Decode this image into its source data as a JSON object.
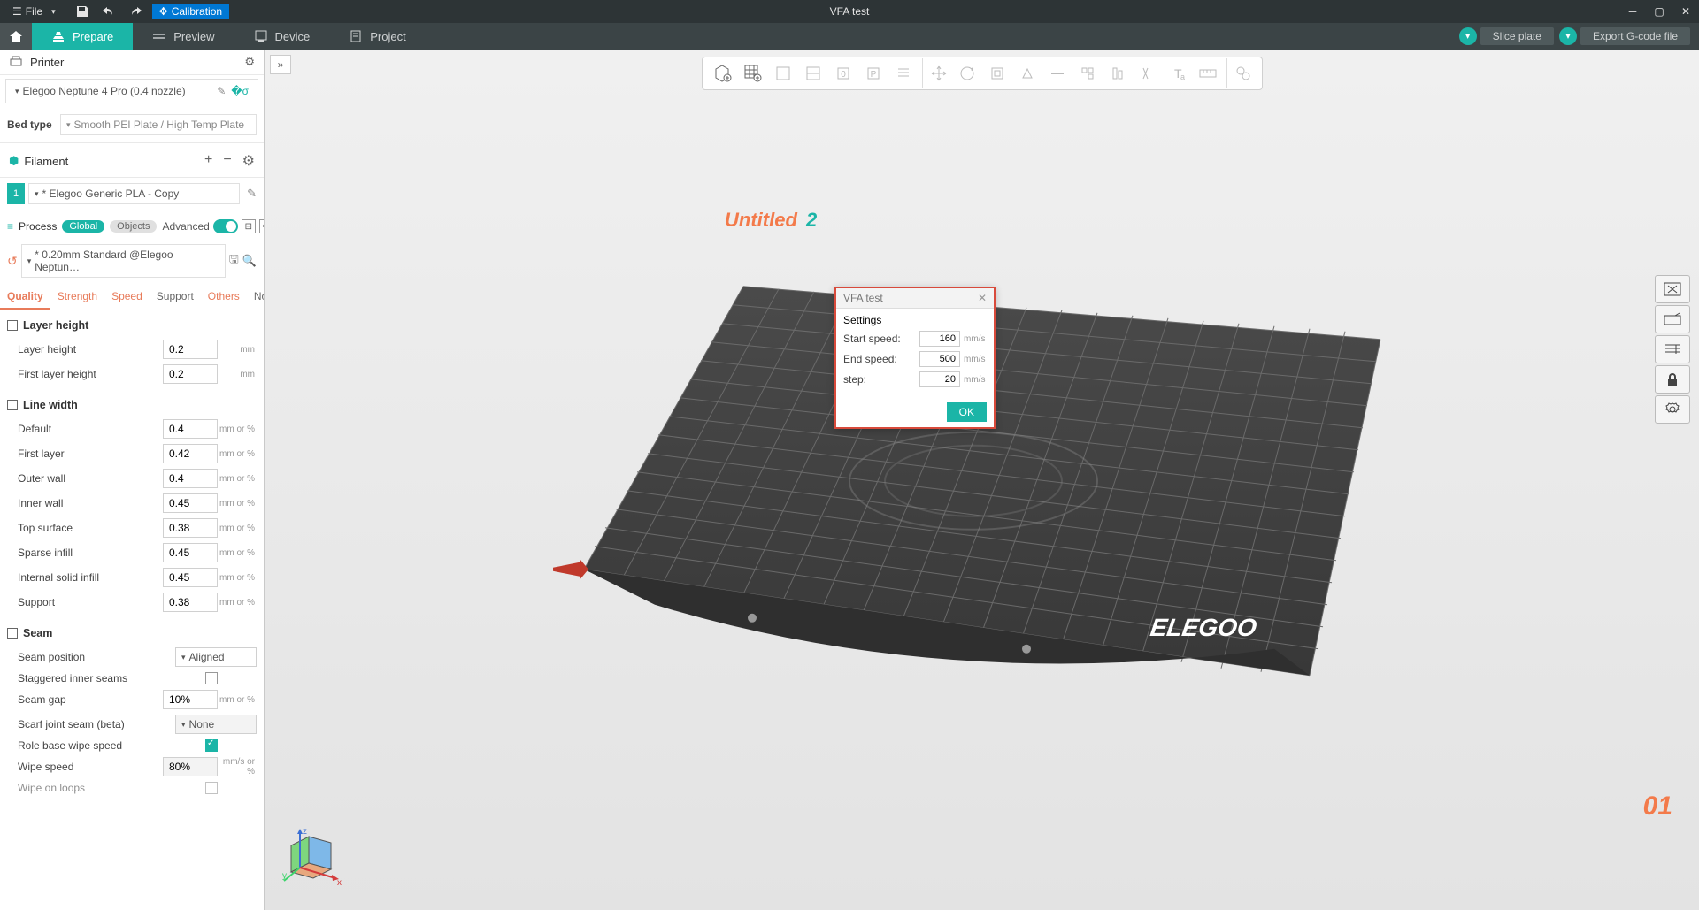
{
  "titlebar": {
    "file_label": "File",
    "calibration_label": "Calibration",
    "title": "VFA test"
  },
  "tabs": {
    "prepare": "Prepare",
    "preview": "Preview",
    "device": "Device",
    "project": "Project"
  },
  "actions": {
    "slice": "Slice plate",
    "export": "Export G-code file"
  },
  "panels": {
    "printer": {
      "title": "Printer",
      "selected": "Elegoo Neptune 4 Pro (0.4 nozzle)",
      "bed_label": "Bed type",
      "bed_selected": "Smooth PEI Plate / High Temp Plate"
    },
    "filament": {
      "title": "Filament",
      "items": [
        {
          "idx": "1",
          "name": "* Elegoo Generic PLA - Copy"
        }
      ]
    },
    "process": {
      "title": "Process",
      "global_badge": "Global",
      "objects_badge": "Objects",
      "advanced_label": "Advanced",
      "selected": "* 0.20mm Standard @Elegoo Neptun…"
    },
    "proc_tabs": {
      "quality": "Quality",
      "strength": "Strength",
      "speed": "Speed",
      "support": "Support",
      "others": "Others",
      "notes": "Notes"
    },
    "groups": {
      "layer_height": {
        "title": "Layer height",
        "rows": [
          {
            "label": "Layer height",
            "value": "0.2",
            "unit": "mm"
          },
          {
            "label": "First layer height",
            "value": "0.2",
            "unit": "mm"
          }
        ]
      },
      "line_width": {
        "title": "Line width",
        "rows": [
          {
            "label": "Default",
            "value": "0.4",
            "unit": "mm or %"
          },
          {
            "label": "First layer",
            "value": "0.42",
            "unit": "mm or %"
          },
          {
            "label": "Outer wall",
            "value": "0.4",
            "unit": "mm or %"
          },
          {
            "label": "Inner wall",
            "value": "0.45",
            "unit": "mm or %"
          },
          {
            "label": "Top surface",
            "value": "0.38",
            "unit": "mm or %"
          },
          {
            "label": "Sparse infill",
            "value": "0.45",
            "unit": "mm or %"
          },
          {
            "label": "Internal solid infill",
            "value": "0.45",
            "unit": "mm or %"
          },
          {
            "label": "Support",
            "value": "0.38",
            "unit": "mm or %"
          }
        ]
      },
      "seam": {
        "title": "Seam",
        "position_label": "Seam position",
        "position_val": "Aligned",
        "staggered_label": "Staggered inner seams",
        "gap_label": "Seam gap",
        "gap_val": "10%",
        "gap_unit": "mm or %",
        "scarf_label": "Scarf joint seam (beta)",
        "scarf_val": "None",
        "role_label": "Role base wipe speed",
        "wipe_label": "Wipe speed",
        "wipe_val": "80%",
        "wipe_unit": "mm/s or %",
        "wipe_loops_label": "Wipe on loops"
      }
    }
  },
  "viewport": {
    "plate_name": "Untitled",
    "plate_idx": "2",
    "plate_no": "01",
    "brand": "ELEGOO"
  },
  "dialog": {
    "title": "VFA test",
    "settings_label": "Settings",
    "start_label": "Start speed:",
    "start_val": "160",
    "end_label": "End speed:",
    "end_val": "500",
    "step_label": "step:",
    "step_val": "20",
    "unit": "mm/s",
    "ok": "OK"
  }
}
